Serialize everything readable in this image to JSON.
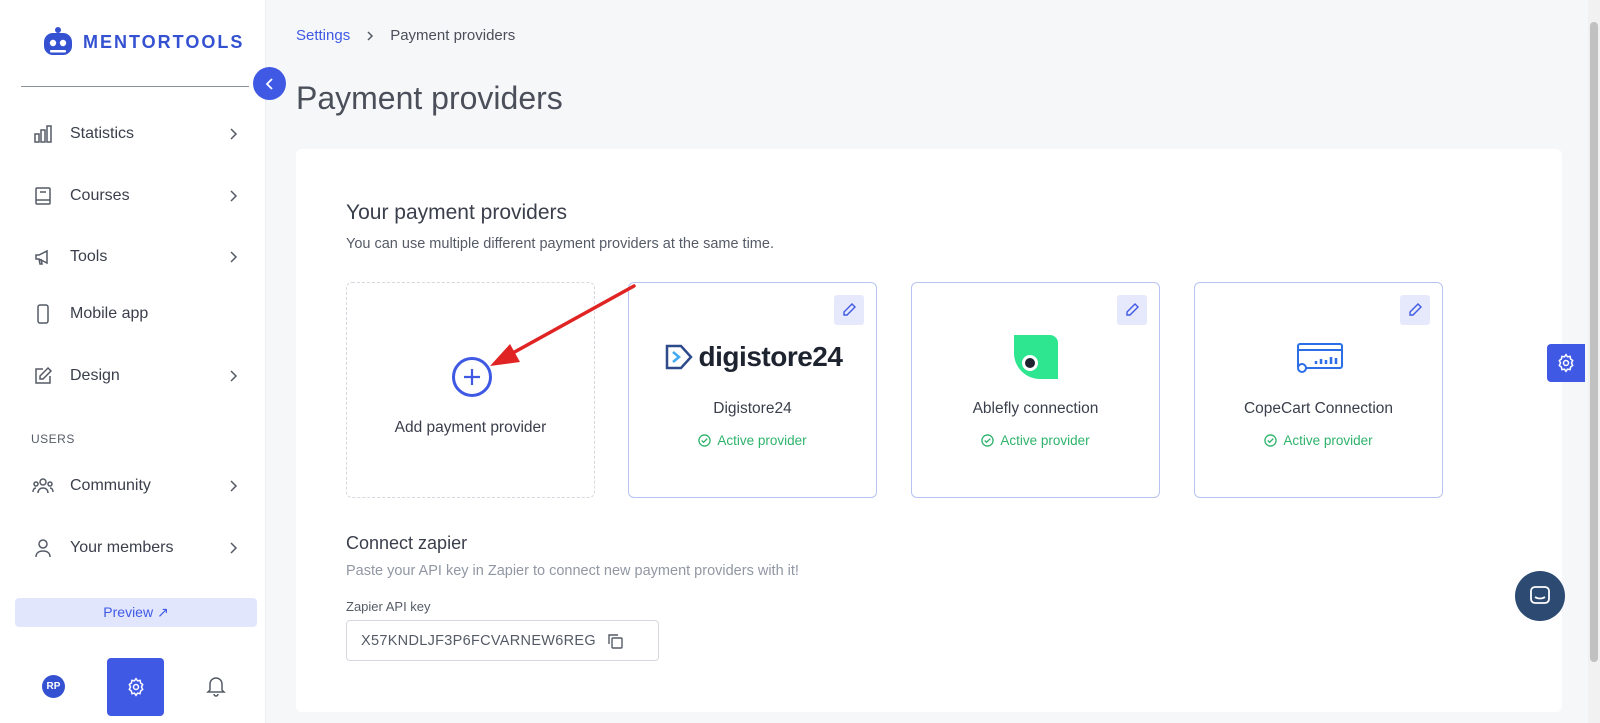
{
  "app": {
    "brand": "MENTORTOOLS",
    "accent": "#3f59e4"
  },
  "sidebar": {
    "items": [
      {
        "label": "Statistics",
        "icon": "bar-chart-icon"
      },
      {
        "label": "Courses",
        "icon": "book-icon"
      },
      {
        "label": "Tools",
        "icon": "megaphone-icon"
      },
      {
        "label": "Mobile app",
        "icon": "phone-icon"
      },
      {
        "label": "Design",
        "icon": "pen-icon"
      }
    ],
    "users_section": "USERS",
    "user_items": [
      {
        "label": "Community",
        "icon": "people-icon"
      },
      {
        "label": "Your members",
        "icon": "person-icon"
      }
    ],
    "preview_label": "Preview ↗",
    "avatar_initials": "RP"
  },
  "breadcrumb": {
    "parent": "Settings",
    "current": "Payment providers"
  },
  "page": {
    "title": "Payment providers"
  },
  "providers": {
    "title": "Your payment providers",
    "subtitle": "You can use multiple different payment providers at the same time.",
    "add_label": "Add payment provider",
    "items": [
      {
        "name": "Digistore24",
        "status": "Active provider",
        "logo_text": "digistore24"
      },
      {
        "name": "Ablefly connection",
        "status": "Active provider"
      },
      {
        "name": "CopeCart Connection",
        "status": "Active provider"
      }
    ]
  },
  "zapier": {
    "title": "Connect zapier",
    "subtitle": "Paste your API key in Zapier to connect new payment providers with it!",
    "label": "Zapier API key",
    "value": "X57KNDLJF3P6FCVARNEW6REG"
  }
}
